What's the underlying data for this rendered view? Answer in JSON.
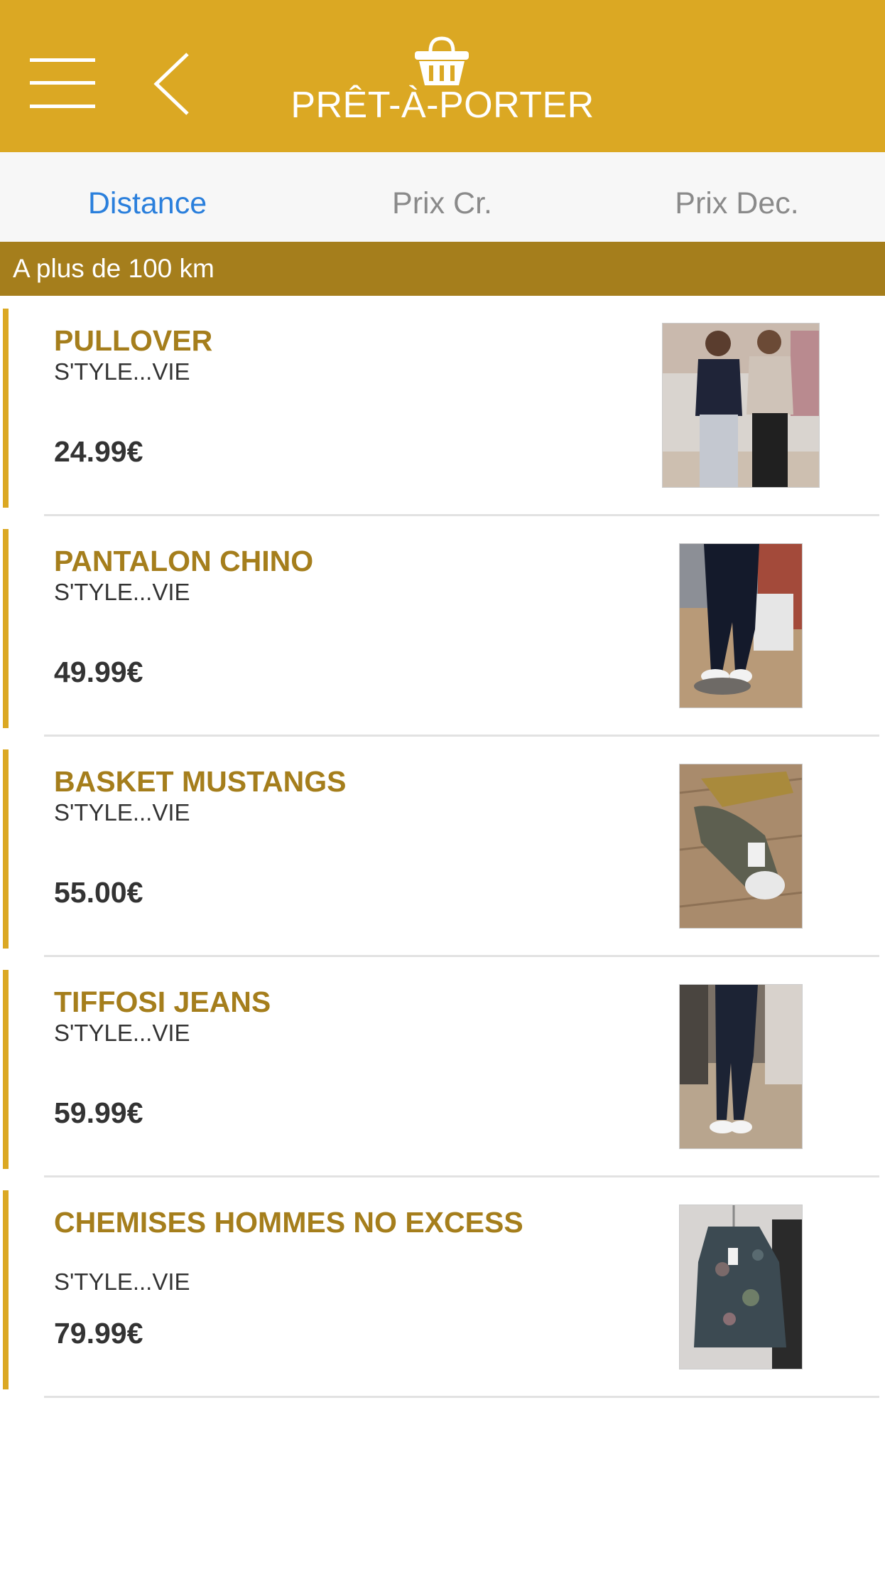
{
  "header": {
    "title": "PRÊT-À-PORTER",
    "color": "#dba823"
  },
  "tabs": [
    {
      "label": "Distance",
      "active": true
    },
    {
      "label": "Prix Cr.",
      "active": false
    },
    {
      "label": "Prix Dec.",
      "active": false
    }
  ],
  "section": {
    "label": "A plus de 100 km",
    "color": "#a57e1c"
  },
  "products": [
    {
      "name": "PULLOVER",
      "shop": "S'TYLE...VIE",
      "price": "24.99€"
    },
    {
      "name": "PANTALON CHINO",
      "shop": "S'TYLE...VIE",
      "price": "49.99€"
    },
    {
      "name": "BASKET MUSTANGS",
      "shop": "S'TYLE...VIE",
      "price": "55.00€"
    },
    {
      "name": "TIFFOSI JEANS",
      "shop": "S'TYLE...VIE",
      "price": "59.99€"
    },
    {
      "name": "CHEMISES HOMMES NO EXCESS",
      "shop": "S'TYLE...VIE",
      "price": "79.99€"
    }
  ],
  "icons": {
    "menu": "hamburger-menu-icon",
    "back": "chevron-left-icon",
    "basket": "shopping-basket-icon"
  },
  "colors": {
    "accent": "#dba823",
    "dark_accent": "#a57e1c",
    "active_tab": "#2a7fdc"
  }
}
